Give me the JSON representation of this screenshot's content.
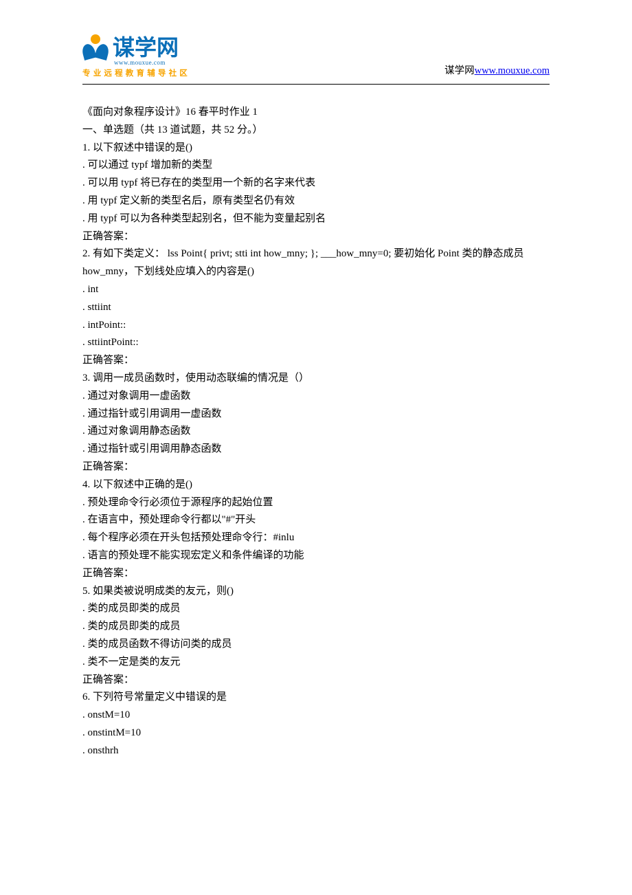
{
  "header": {
    "logo_cn": "谋学网",
    "logo_url": "www.mouxue.com",
    "logo_tagline": "专业远程教育辅导社区",
    "right_prefix": "谋学网",
    "right_link": "www.mouxue.com"
  },
  "title": "《面向对象程序设计》16 春平时作业 1",
  "section_heading": "一、单选题（共 13 道试题，共 52 分。）",
  "questions": [
    {
      "stem": "1.  以下叙述中错误的是()",
      "options": [
        ". 可以通过 typf 增加新的类型",
        ". 可以用 typf 将已存在的类型用一个新的名字来代表",
        ". 用 typf 定义新的类型名后，原有类型名仍有效",
        ". 用 typf 可以为各种类型起别名，但不能为变量起别名"
      ],
      "answer_label": "正确答案："
    },
    {
      "stem": "2.  有如下类定义： lss Point{ privt; stti int how_mny; }; ___how_mny=0; 要初始化 Point 类的静态成员 how_mny，下划线处应填入的内容是()",
      "options": [
        ". int",
        ". sttiint",
        ". intPoint::",
        ". sttiintPoint::"
      ],
      "answer_label": "正确答案："
    },
    {
      "stem": "3.  调用一成员函数时，使用动态联编的情况是（）",
      "options": [
        ". 通过对象调用一虚函数",
        ". 通过指针或引用调用一虚函数",
        ". 通过对象调用静态函数",
        ". 通过指针或引用调用静态函数"
      ],
      "answer_label": "正确答案："
    },
    {
      "stem": "4.  以下叙述中正确的是()",
      "options": [
        ". 预处理命令行必须位于源程序的起始位置",
        ". 在语言中，预处理命令行都以\"#\"开头",
        ". 每个程序必须在开头包括预处理命令行：#inlu",
        ". 语言的预处理不能实现宏定义和条件编译的功能"
      ],
      "answer_label": "正确答案："
    },
    {
      "stem": "5.  如果类被说明成类的友元，则()",
      "options": [
        ". 类的成员即类的成员",
        ". 类的成员即类的成员",
        ". 类的成员函数不得访问类的成员",
        ". 类不一定是类的友元"
      ],
      "answer_label": "正确答案："
    },
    {
      "stem": "6.  下列符号常量定义中错误的是",
      "options": [
        ". onstM=10",
        ". onstintM=10",
        ". onsthrh"
      ],
      "answer_label": ""
    }
  ]
}
